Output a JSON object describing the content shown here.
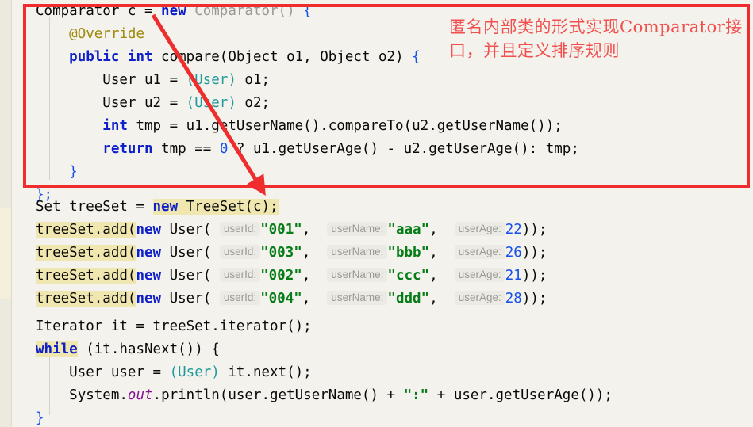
{
  "editor": {
    "language": "java",
    "background_color": "#f3f2ec",
    "gutter_color": "#eceadf",
    "highlight_color": "#f0e6b0",
    "current_line_color": "#fbf8e9",
    "code_lines": [
      "Comparator c = new Comparator() {",
      "    @Override",
      "    public int compare(Object o1, Object o2) {",
      "        User u1 = (User) o1;",
      "        User u2 = (User) o2;",
      "        int tmp = u1.getUserName().compareTo(u2.getUserName());",
      "        return tmp == 0 ? u1.getUserAge() - u2.getUserAge(): tmp;",
      "    }",
      "};",
      "Set treeSet = new TreeSet(c);",
      "treeSet.add(new User( userId: \"001\",  userName: \"aaa\",  userAge: 22));",
      "treeSet.add(new User( userId: \"003\",  userName: \"bbb\",  userAge: 26));",
      "treeSet.add(new User( userId: \"002\",  userName: \"ccc\",  userAge: 21));",
      "treeSet.add(new User( userId: \"004\",  userName: \"ddd\",  userAge: 28));",
      "",
      "Iterator it = treeSet.iterator();",
      "while (it.hasNext()) {",
      "    User user = (User) it.next();",
      "    System.out.println(user.getUserName() + \":\" + user.getUserAge());",
      "}"
    ],
    "parameter_hints": {
      "user_id": "userId:",
      "user_name": "userName:",
      "user_age": "userAge:"
    },
    "user_entries": [
      {
        "userId": "\"001\"",
        "userName": "\"aaa\"",
        "userAge": "22"
      },
      {
        "userId": "\"003\"",
        "userName": "\"bbb\"",
        "userAge": "26"
      },
      {
        "userId": "\"002\"",
        "userName": "\"ccc\"",
        "userAge": "21"
      },
      {
        "userId": "\"004\"",
        "userName": "\"ddd\"",
        "userAge": "28"
      }
    ],
    "tokens": {
      "l1_a": "Comparator c = ",
      "l1_new": "new",
      "l1_b": " Comparator() ",
      "l1_brace": "{",
      "l2_override": "@Override",
      "l3_mod": "public int",
      "l3_name": " compare(Object o1, Object o2) ",
      "l3_brace": "{",
      "l4_a": "User u1 = ",
      "l4_cast": "(User)",
      "l4_b": " o1;",
      "l5_a": "User u2 = ",
      "l5_cast": "(User)",
      "l5_b": " o2;",
      "l6_kw": "int",
      "l6_rest": " tmp = u1.getUserName().compareTo(u2.getUserName());",
      "l7_kw": "return",
      "l7_a": " tmp == ",
      "l7_num": "0",
      "l7_b": " ? u1.getUserAge() - u2.getUserAge(): tmp;",
      "l8_brace": "}",
      "l9_end": "};",
      "l10_a": "Set treeSet = ",
      "l10_new": "new",
      "l10_b": " TreeSet(c);",
      "add_prefix": "treeSet.add(",
      "add_new": "new",
      "add_user": " User( ",
      "add_tail": "));",
      "l15_iter": "Iterator it = treeSet.iterator();",
      "l16_kw": "while",
      "l16_rest": " (it.hasNext()) {",
      "l17": "User user = ",
      "l17_cast": "(User)",
      "l17_b": " it.next();",
      "l18_sys": "System.",
      "l18_out": "out",
      "l18_a": ".println(user.getUserName() + ",
      "l18_str": "\":\"",
      "l18_b": " + user.getUserAge());",
      "l19_brace": "}"
    }
  },
  "annotation": {
    "text_line1": "匿名内部类的形式实现Comparator接",
    "text_line2": "口，并且定义排序规则",
    "color": "#f1504f",
    "box_color": "#ef2d2d",
    "arrow_color": "#ef2d2d"
  },
  "watermark": {
    "name": "doraemon-watermark"
  }
}
